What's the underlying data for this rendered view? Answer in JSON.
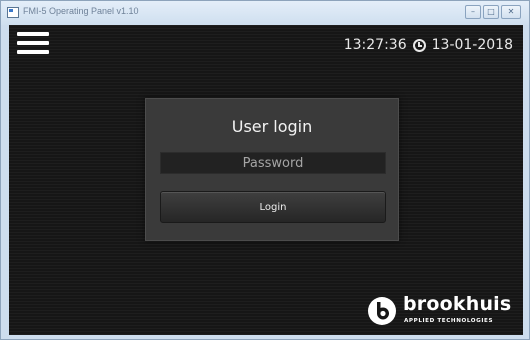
{
  "window": {
    "title": "FMI-5 Operating Panel v1.10",
    "controls": {
      "minimize": "–",
      "maximize": "□",
      "close": "✕"
    }
  },
  "header": {
    "menu_icon": "hamburger-menu-icon",
    "time": "13:27:36",
    "clock_icon": "clock-icon",
    "date": "13-01-2018"
  },
  "login": {
    "title": "User login",
    "password_placeholder": "Password",
    "password_value": "",
    "button_label": "Login"
  },
  "brand": {
    "name": "brookhuis",
    "tagline": "APPLIED TECHNOLOGIES",
    "logo_icon": "brookhuis-logo-icon"
  },
  "colors": {
    "background": "#161616",
    "panel": "#3a3a3a",
    "field": "#222222",
    "text": "#f2f2f2"
  }
}
